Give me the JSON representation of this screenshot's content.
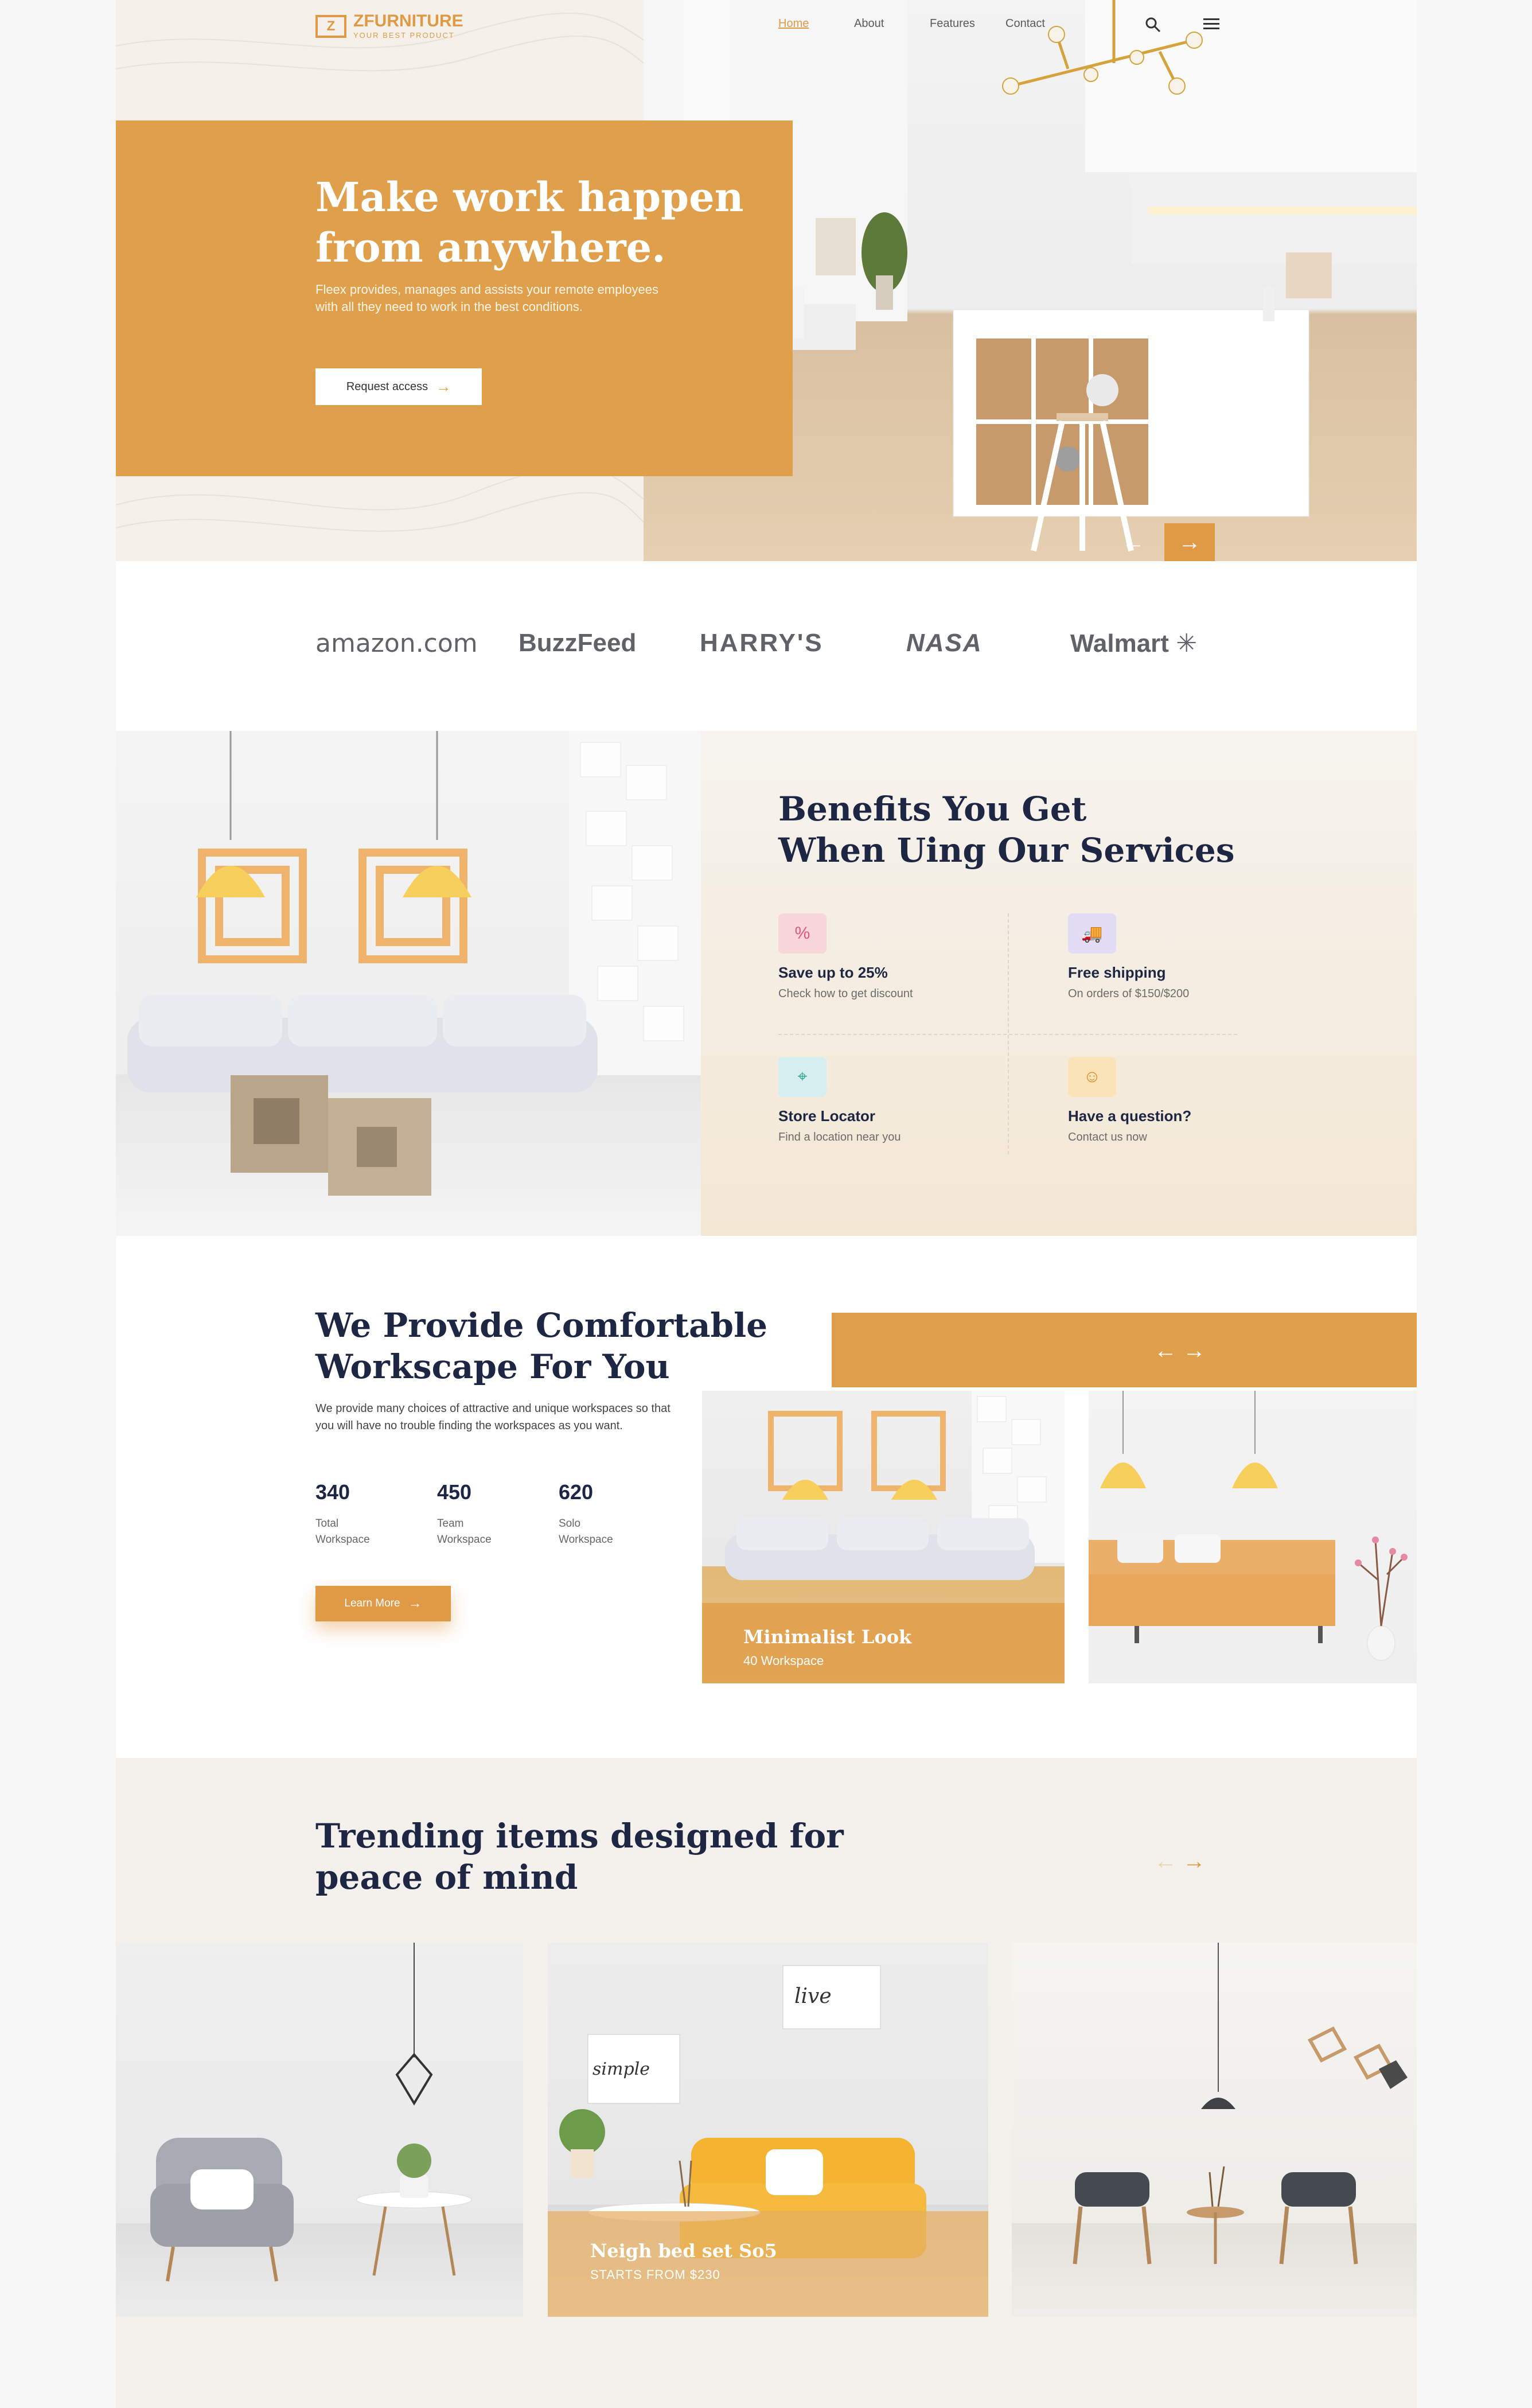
{
  "brand": {
    "logo_mark": "Z",
    "name": "ZFURNITURE",
    "tagline": "YOUR BEST PRODUCT"
  },
  "nav": {
    "items": [
      {
        "label": "Home",
        "active": true
      },
      {
        "label": "About",
        "active": false
      },
      {
        "label": "Features",
        "active": false
      },
      {
        "label": "Contact",
        "active": false
      }
    ],
    "search_icon": "search-icon",
    "menu_icon": "hamburger-menu-icon"
  },
  "hero": {
    "title_line1": "Make work happen",
    "title_line2": "from anywhere.",
    "description": "Fleex provides, manages and assists your remote employees with all they need to work in the best conditions.",
    "button_label": "Request access",
    "prev_arrow": "←",
    "next_arrow": "→"
  },
  "brands": [
    "amazon.com",
    "BuzzFeed",
    "HARRY'S",
    "NASA",
    "Walmart"
  ],
  "benefits": {
    "title_line1": "Benefits You Get",
    "title_line2": "When Uing Our Services",
    "items": [
      {
        "icon": "discount-icon",
        "title": "Save up to 25%",
        "subtitle": "Check how to get discount",
        "color": "#f9d6dc"
      },
      {
        "icon": "free-shipping-icon",
        "title": "Free shipping",
        "subtitle": "On orders of $150/$200",
        "color": "#e3dcf5"
      },
      {
        "icon": "location-pin-icon",
        "title": "Store Locator",
        "subtitle": "Find a location near you",
        "color": "#d7eef0"
      },
      {
        "icon": "support-agent-icon",
        "title": "Have a question?",
        "subtitle": "Contact us now",
        "color": "#fbe3b8"
      }
    ]
  },
  "workspace": {
    "title_line1": "We Provide Comfortable",
    "title_line2": "Workscape For You",
    "description": "We provide many choices of attractive and unique workspaces so that you will have no trouble finding the workspaces as you want.",
    "stats": [
      {
        "value": "340",
        "label_line1": "Total",
        "label_line2": "Workspace"
      },
      {
        "value": "450",
        "label_line1": "Team",
        "label_line2": "Workspace"
      },
      {
        "value": "620",
        "label_line1": "Solo",
        "label_line2": "Workspace"
      }
    ],
    "button_label": "Learn More",
    "arrows": "←→",
    "cards": [
      {
        "title": "Minimalist Look",
        "subtitle": "40 Workspace"
      }
    ]
  },
  "trending": {
    "title_line1": "Trending items designed for",
    "title_line2": "peace of mind",
    "arrow_prev": "←",
    "arrow_next": "→",
    "cards": [
      {
        "title": "Neigh bed set So5",
        "subtitle": "STARTS FROM $230"
      }
    ],
    "wall_art": [
      "simple",
      "live"
    ]
  },
  "colors": {
    "accent": "#e09f4b",
    "navy": "#1d2744",
    "cream": "#f4f1ec"
  }
}
